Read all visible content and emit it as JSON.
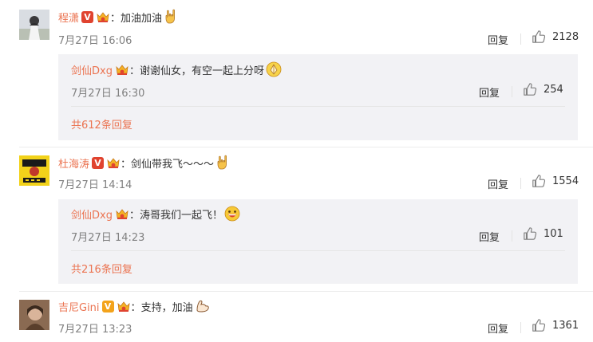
{
  "comments": [
    {
      "user": "程潇",
      "text": "加油加油",
      "time": "7月27日 16:06",
      "reply_label": "回复",
      "likes": "2128",
      "sub_reply": {
        "user": "剑仙Dxg",
        "text": "谢谢仙女，有空一起上分呀",
        "time": "7月27日 16:30",
        "reply_label": "回复",
        "likes": "254"
      },
      "more_label": "共612条回复"
    },
    {
      "user": "杜海涛",
      "text": "剑仙带我飞～～～",
      "time": "7月27日 14:14",
      "reply_label": "回复",
      "likes": "1554",
      "sub_reply": {
        "user": "剑仙Dxg",
        "text": "涛哥我们一起飞！",
        "time": "7月27日 14:23",
        "reply_label": "回复",
        "likes": "101"
      },
      "more_label": "共216条回复"
    },
    {
      "user": "吉尼Gini",
      "text": "支持，加油",
      "time": "7月27日 13:23",
      "reply_label": "回复",
      "likes": "1361"
    }
  ],
  "colors": {
    "username": "#eb7350",
    "text": "#333333",
    "time": "#808080",
    "sub_bg": "#f2f2f5",
    "v_red": "#e0432f",
    "v_gold": "#f3a31b"
  },
  "icons": [
    "verified-v-icon",
    "crown-badge-icon",
    "thumbs-up-icon",
    "rock-hand-emoji",
    "grin-emoji",
    "muscle-emoji",
    "pray-emoji"
  ]
}
